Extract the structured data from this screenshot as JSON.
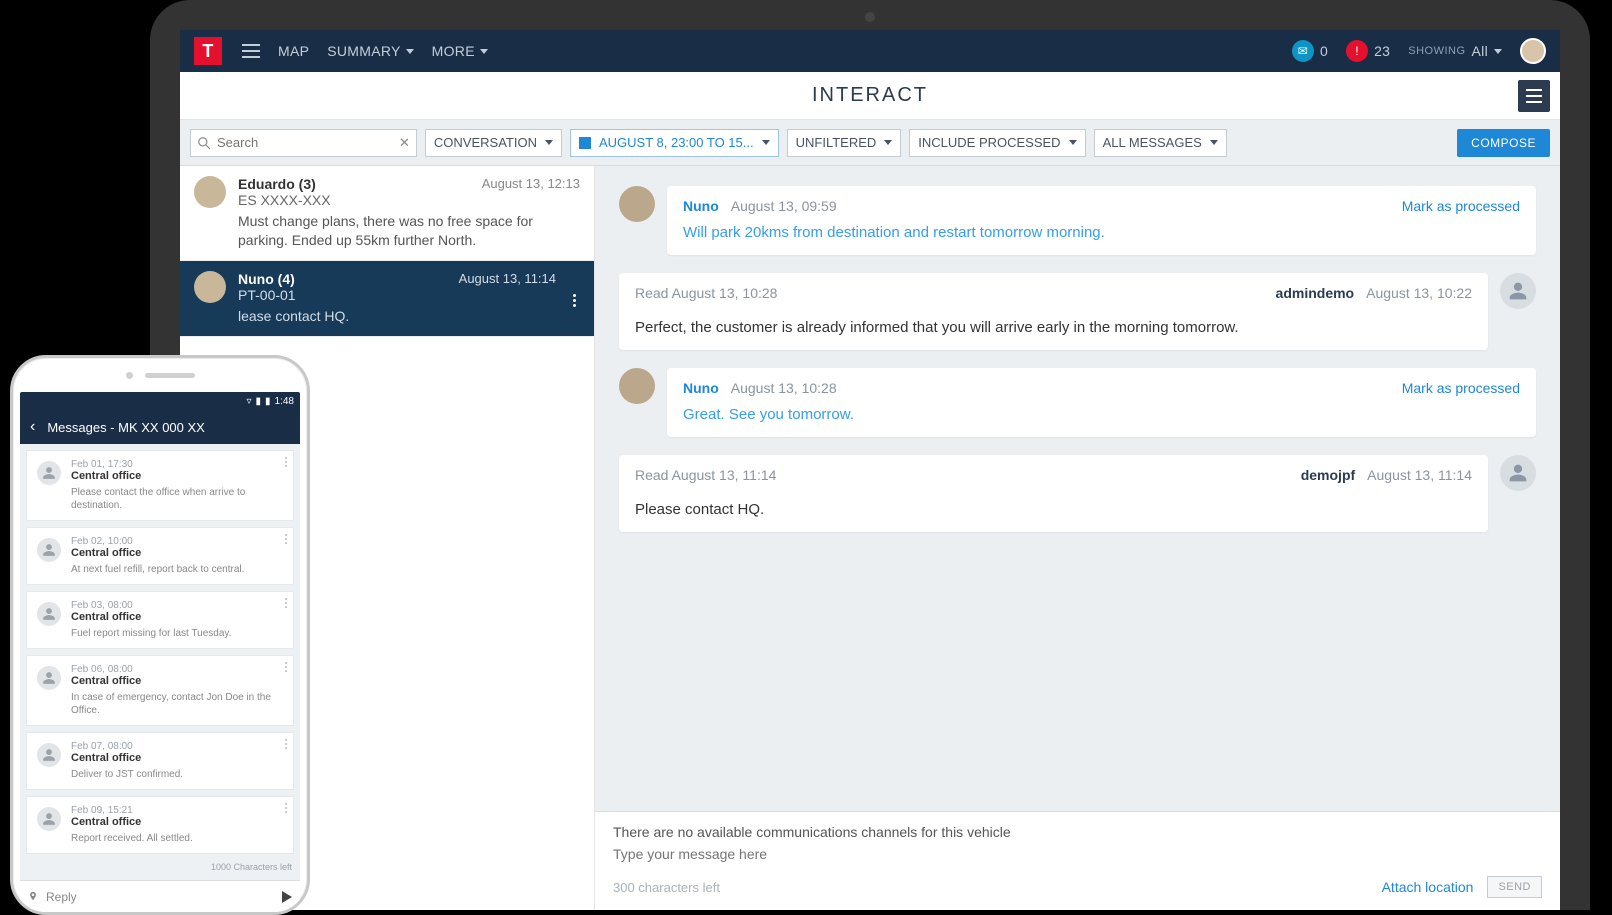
{
  "nav": {
    "map": "MAP",
    "summary": "SUMMARY",
    "more": "MORE",
    "mail_count": "0",
    "alert_count": "23",
    "showing_label": "SHOWING",
    "showing_value": "All"
  },
  "page_title": "INTERACT",
  "filters": {
    "search_placeholder": "Search",
    "conversation": "CONVERSATION",
    "date_range": "AUGUST 8, 23:00 TO 15...",
    "unfiltered": "UNFILTERED",
    "include_processed": "INCLUDE PROCESSED",
    "all_messages": "ALL MESSAGES",
    "compose": "COMPOSE"
  },
  "conversations": [
    {
      "name": "Eduardo (3)",
      "time": "August 13, 12:13",
      "sub": "ES XXXX-XXX",
      "preview": "Must change plans, there was no free space for parking. Ended up 55km further North."
    },
    {
      "name": "Nuno (4)",
      "time": "August 13, 11:14",
      "sub": "PT-00-01",
      "preview": "lease contact HQ."
    }
  ],
  "thread": [
    {
      "side": "left",
      "name": "Nuno",
      "time": "August 13, 09:59",
      "action": "Mark as processed",
      "text": "Will park 20kms from destination and restart tomorrow morning.",
      "blue": true
    },
    {
      "side": "right",
      "read": "Read August 13, 10:28",
      "name": "admindemo",
      "time": "August 13, 10:22",
      "text": "Perfect, the customer is already informed that you will arrive early in the morning tomorrow."
    },
    {
      "side": "left",
      "name": "Nuno",
      "time": "August 13, 10:28",
      "action": "Mark as processed",
      "text": "Great. See you tomorrow.",
      "blue": true
    },
    {
      "side": "right",
      "read": "Read August 13, 11:14",
      "name": "demojpf",
      "time": "August 13, 11:14",
      "text": "Please contact HQ."
    }
  ],
  "composer": {
    "warning": "There are no available communications channels for this vehicle",
    "placeholder": "Type your message here",
    "chars_left": "300 characters left",
    "attach": "Attach location",
    "send": "SEND"
  },
  "phone": {
    "status_time": "1:48",
    "title": "Messages - MK XX 000 XX",
    "chars_left": "1000 Characters left",
    "reply_placeholder": "Reply",
    "messages": [
      {
        "time": "Feb 01, 17:30",
        "sender": "Central office",
        "preview": "Please contact the office when arrive to destination."
      },
      {
        "time": "Feb 02, 10:00",
        "sender": "Central office",
        "preview": "At next fuel refill, report back to central."
      },
      {
        "time": "Feb 03, 08:00",
        "sender": "Central office",
        "preview": "Fuel report missing for last Tuesday."
      },
      {
        "time": "Feb 06, 08:00",
        "sender": "Central office",
        "preview": "In case of emergency, contact Jon Doe in the Office."
      },
      {
        "time": "Feb 07, 08:00",
        "sender": "Central office",
        "preview": "Deliver to JST confirmed."
      },
      {
        "time": "Feb 09, 15:21",
        "sender": "Central office",
        "preview": "Report received. All settled."
      }
    ]
  }
}
